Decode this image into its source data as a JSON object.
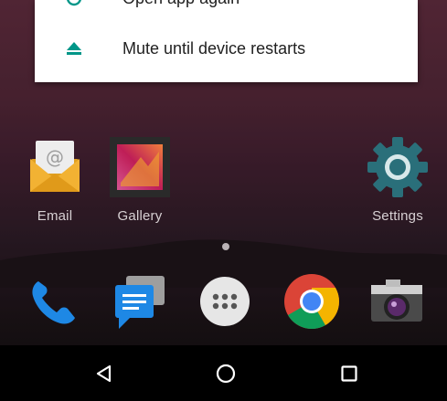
{
  "dialog": {
    "items": [
      {
        "label": "Open app again",
        "icon": "clock-icon"
      },
      {
        "label": "Mute until device restarts",
        "icon": "eject-icon"
      }
    ],
    "accent": "#009688"
  },
  "home": {
    "apps": [
      {
        "label": "Email",
        "icon": "email-icon"
      },
      {
        "label": "Gallery",
        "icon": "gallery-icon"
      },
      {
        "label": "Settings",
        "icon": "gear-icon"
      }
    ],
    "page_indicator": {
      "count": 1,
      "active": 0
    }
  },
  "dock": [
    {
      "name": "phone",
      "icon": "phone-icon"
    },
    {
      "name": "messages",
      "icon": "messages-icon"
    },
    {
      "name": "app drawer",
      "icon": "app-drawer-icon"
    },
    {
      "name": "chrome",
      "icon": "chrome-icon"
    },
    {
      "name": "camera",
      "icon": "camera-icon"
    }
  ],
  "navbar": {
    "buttons": [
      {
        "name": "back",
        "icon": "back-triangle-icon"
      },
      {
        "name": "home",
        "icon": "home-circle-icon"
      },
      {
        "name": "recents",
        "icon": "recents-square-icon"
      }
    ]
  }
}
